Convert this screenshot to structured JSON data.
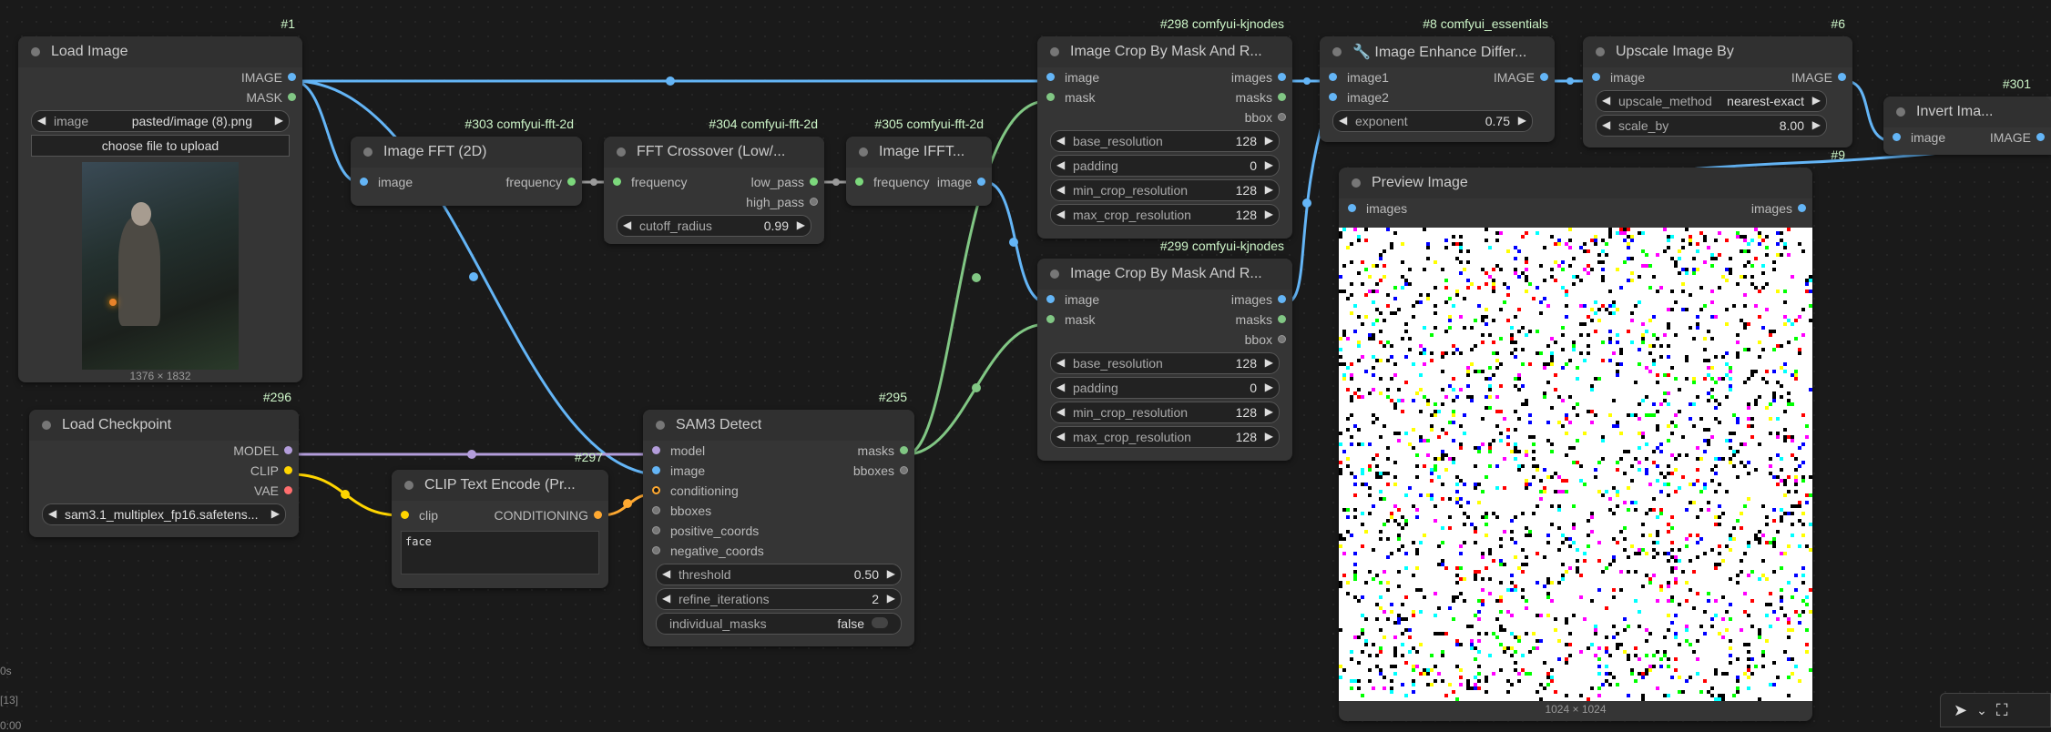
{
  "nodes": {
    "load_image": {
      "badge": "#1",
      "title": "Load Image",
      "outputs": [
        "IMAGE",
        "MASK"
      ],
      "image_widget": {
        "label": "image",
        "value": "pasted/image (8).png"
      },
      "upload_label": "choose file to upload",
      "caption": "1376 × 1832"
    },
    "image_fft": {
      "badge": "#303 comfyui-fft-2d",
      "title": "Image FFT (2D)",
      "input": "image",
      "output": "frequency"
    },
    "fft_crossover": {
      "badge": "#304 comfyui-fft-2d",
      "title": "FFT Crossover (Low/...",
      "input": "frequency",
      "outputs": [
        "low_pass",
        "high_pass"
      ],
      "widget": {
        "label": "cutoff_radius",
        "value": "0.99"
      }
    },
    "image_ifft": {
      "badge": "#305 comfyui-fft-2d",
      "title": "Image IFFT...",
      "input": "frequency",
      "output": "image"
    },
    "crop1": {
      "badge": "#298 comfyui-kjnodes",
      "title": "Image Crop By Mask And R...",
      "inputs": [
        "image",
        "mask"
      ],
      "outputs": [
        "images",
        "masks",
        "bbox"
      ],
      "widgets": [
        {
          "label": "base_resolution",
          "value": "128"
        },
        {
          "label": "padding",
          "value": "0"
        },
        {
          "label": "min_crop_resolution",
          "value": "128"
        },
        {
          "label": "max_crop_resolution",
          "value": "128"
        }
      ]
    },
    "crop2": {
      "badge": "#299 comfyui-kjnodes",
      "title": "Image Crop By Mask And R...",
      "inputs": [
        "image",
        "mask"
      ],
      "outputs": [
        "images",
        "masks",
        "bbox"
      ],
      "widgets": [
        {
          "label": "base_resolution",
          "value": "128"
        },
        {
          "label": "padding",
          "value": "0"
        },
        {
          "label": "min_crop_resolution",
          "value": "128"
        },
        {
          "label": "max_crop_resolution",
          "value": "128"
        }
      ]
    },
    "enhance": {
      "badge": "#8 comfyui_essentials",
      "title": "🔧 Image Enhance Differ...",
      "inputs": [
        "image1",
        "image2"
      ],
      "output": "IMAGE",
      "widget": {
        "label": "exponent",
        "value": "0.75"
      }
    },
    "upscale": {
      "badge": "#6",
      "title": "Upscale Image By",
      "input": "image",
      "output": "IMAGE",
      "widgets": [
        {
          "label": "upscale_method",
          "value": "nearest-exact"
        },
        {
          "label": "scale_by",
          "value": "8.00"
        }
      ]
    },
    "invert": {
      "badge": "#301",
      "title": "Invert Ima...",
      "input": "image",
      "output": "IMAGE"
    },
    "preview": {
      "badge": "#9",
      "title": "Preview Image",
      "input": "images",
      "output": "images",
      "caption": "1024 × 1024"
    },
    "checkpoint": {
      "badge": "#296",
      "title": "Load Checkpoint",
      "outputs": [
        "MODEL",
        "CLIP",
        "VAE"
      ],
      "widget": {
        "value": "sam3.1_multiplex_fp16.safetens..."
      }
    },
    "clip_text": {
      "badge": "#297",
      "title": "CLIP Text Encode (Pr...",
      "input": "clip",
      "output": "CONDITIONING",
      "text": "face"
    },
    "sam3": {
      "badge": "#295",
      "title": "SAM3 Detect",
      "inputs": [
        "model",
        "image",
        "conditioning",
        "bboxes",
        "positive_coords",
        "negative_coords"
      ],
      "outputs": [
        "masks",
        "bboxes"
      ],
      "widgets": [
        {
          "label": "threshold",
          "value": "0.50"
        },
        {
          "label": "refine_iterations",
          "value": "2"
        }
      ],
      "toggle": {
        "label": "individual_masks",
        "value": "false"
      }
    }
  },
  "side_info": [
    "0s",
    "[13]",
    "0:00"
  ],
  "colors": {
    "image": "#64b5f6",
    "mask": "#81c784",
    "model": "#b39ddb",
    "clip": "#ffd500",
    "conditioning": "#ffa931"
  }
}
